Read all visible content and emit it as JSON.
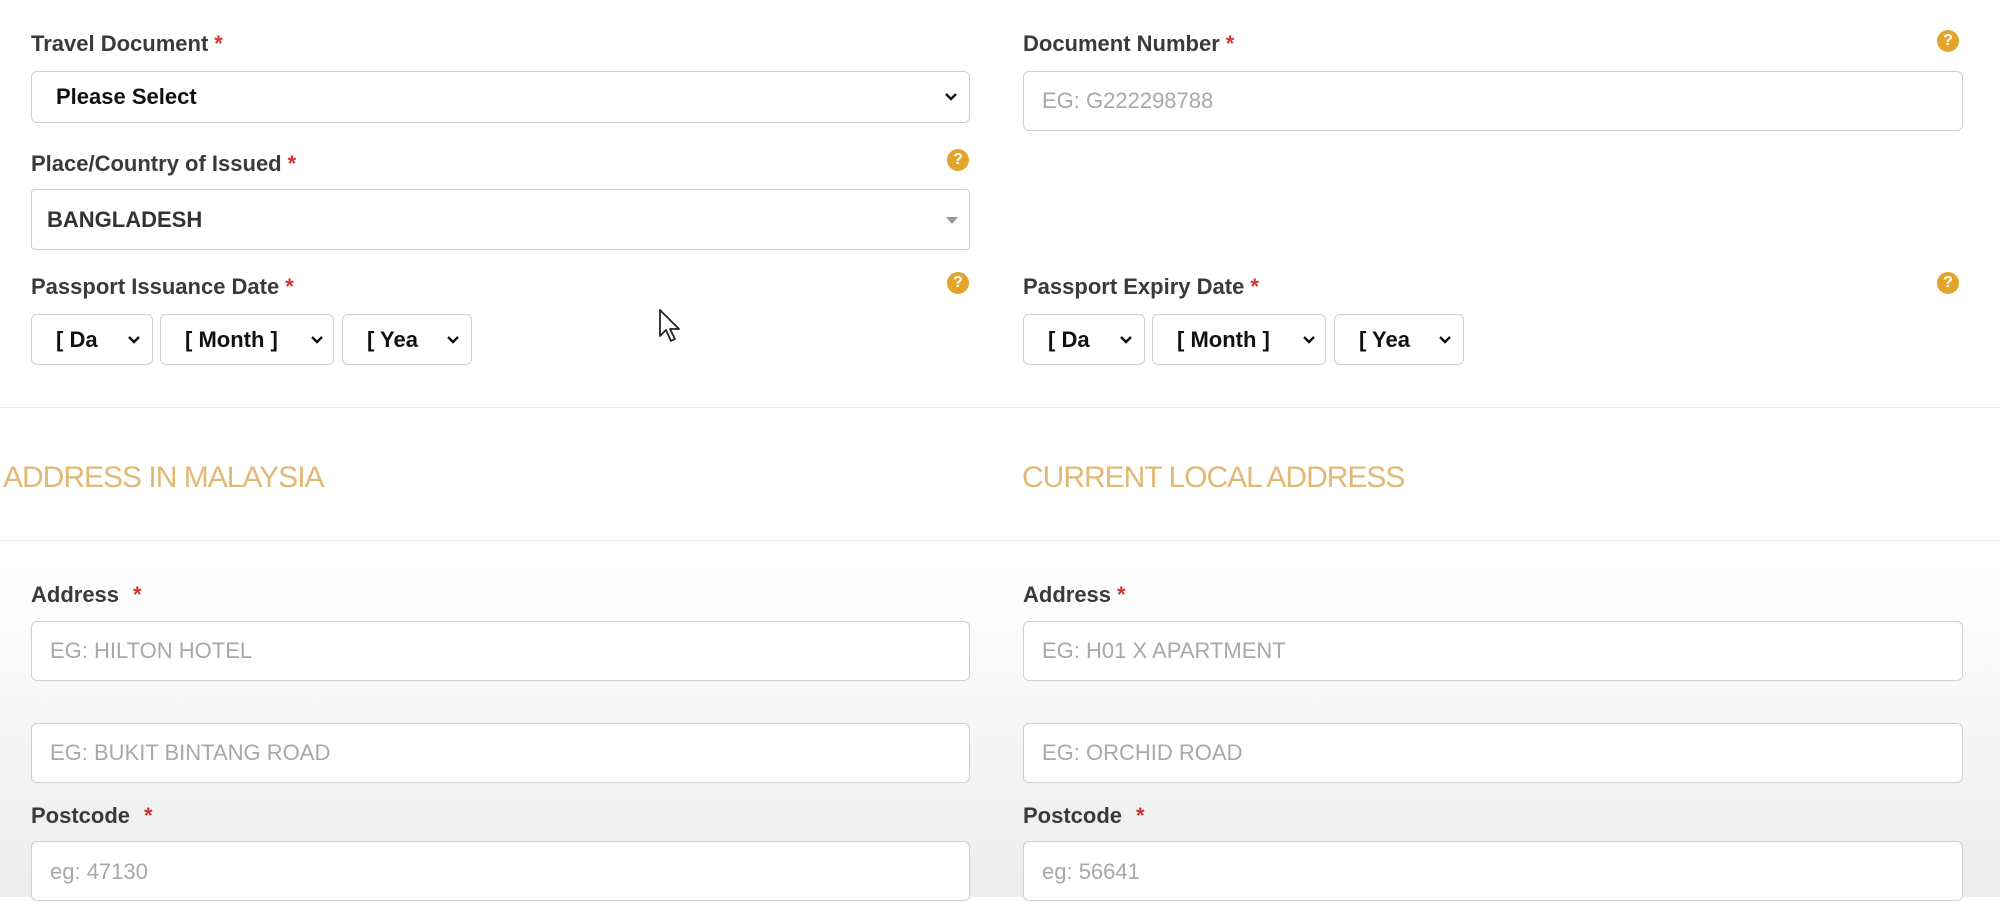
{
  "travel_document": {
    "label": "Travel Document",
    "required": "*",
    "value": "Please Select"
  },
  "document_number": {
    "label": "Document Number",
    "required": "*",
    "placeholder": "EG: G222298788"
  },
  "place_country": {
    "label": "Place/Country of Issued",
    "required": "*",
    "value": "BANGLADESH"
  },
  "passport_issuance": {
    "label": "Passport Issuance Date",
    "required": "*",
    "day": "[ Da",
    "month": "[ Month ]",
    "year": "[ Yea"
  },
  "passport_expiry": {
    "label": "Passport Expiry Date",
    "required": "*",
    "day": "[ Da",
    "month": "[ Month ]",
    "year": "[ Yea"
  },
  "sections": {
    "malaysia": "ADDRESS IN MALAYSIA",
    "local": "CURRENT LOCAL ADDRESS"
  },
  "malaysia_address": {
    "address_label": "Address",
    "required": "*",
    "line1_placeholder": "EG: HILTON HOTEL",
    "line2_placeholder": "EG: BUKIT BINTANG ROAD",
    "postcode_label": "Postcode",
    "postcode_placeholder": "eg: 47130"
  },
  "local_address": {
    "address_label": "Address",
    "required": "*",
    "line1_placeholder": "EG: H01 X APARTMENT",
    "line2_placeholder": "EG: ORCHID ROAD",
    "postcode_label": "Postcode",
    "postcode_placeholder": "eg: 56641"
  },
  "icons": {
    "help": "question-circle-icon",
    "dropdown": "chevron-down-icon",
    "cursor": "mouse-pointer-icon"
  },
  "colors": {
    "accent": "#e0a52a",
    "required": "#d0342c",
    "section": "#e2b974"
  }
}
